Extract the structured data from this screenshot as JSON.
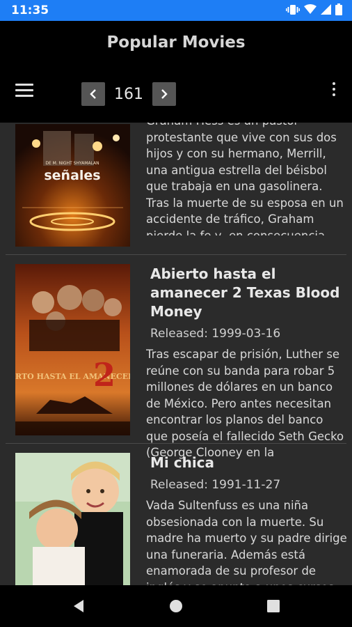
{
  "status": {
    "time": "11:35"
  },
  "header": {
    "title": "Popular Movies",
    "page": "161"
  },
  "movies": [
    {
      "title": "",
      "released": "",
      "overview": "Graham Hess es un pastor protestante que vive con sus dos hijos y con su hermano, Merrill, una antigua estrella del béisbol que trabaja en una gasolinera. Tras la muerte de su esposa en un accidente de tráfico, Graham pierde la fe y, en consecuencia,",
      "poster_title": "señales",
      "poster_tagline": "DE M. NIGHT SHYAMALAN"
    },
    {
      "title": "Abierto hasta el amanecer 2 Texas Blood Money",
      "released": "Released: 1999-03-16",
      "overview": "Tras escapar de prisión, Luther se reúne con su banda para robar 5 millones de dólares en un banco de México. Pero antes necesitan encontrar los planos del banco que poseía el fallecido Seth Gecko (George Clooney en la",
      "poster_title": "ABIERTO HASTA EL AMANECER",
      "poster_number": "2"
    },
    {
      "title": "Mi chica",
      "released": "Released: 1991-11-27",
      "overview": "Vada Sultenfuss es una niña obsesionada con la muerte. Su madre ha muerto y su padre dirige una funeraria. Además está enamorada de su profesor de inglés y se apunta a unos cursos"
    }
  ]
}
